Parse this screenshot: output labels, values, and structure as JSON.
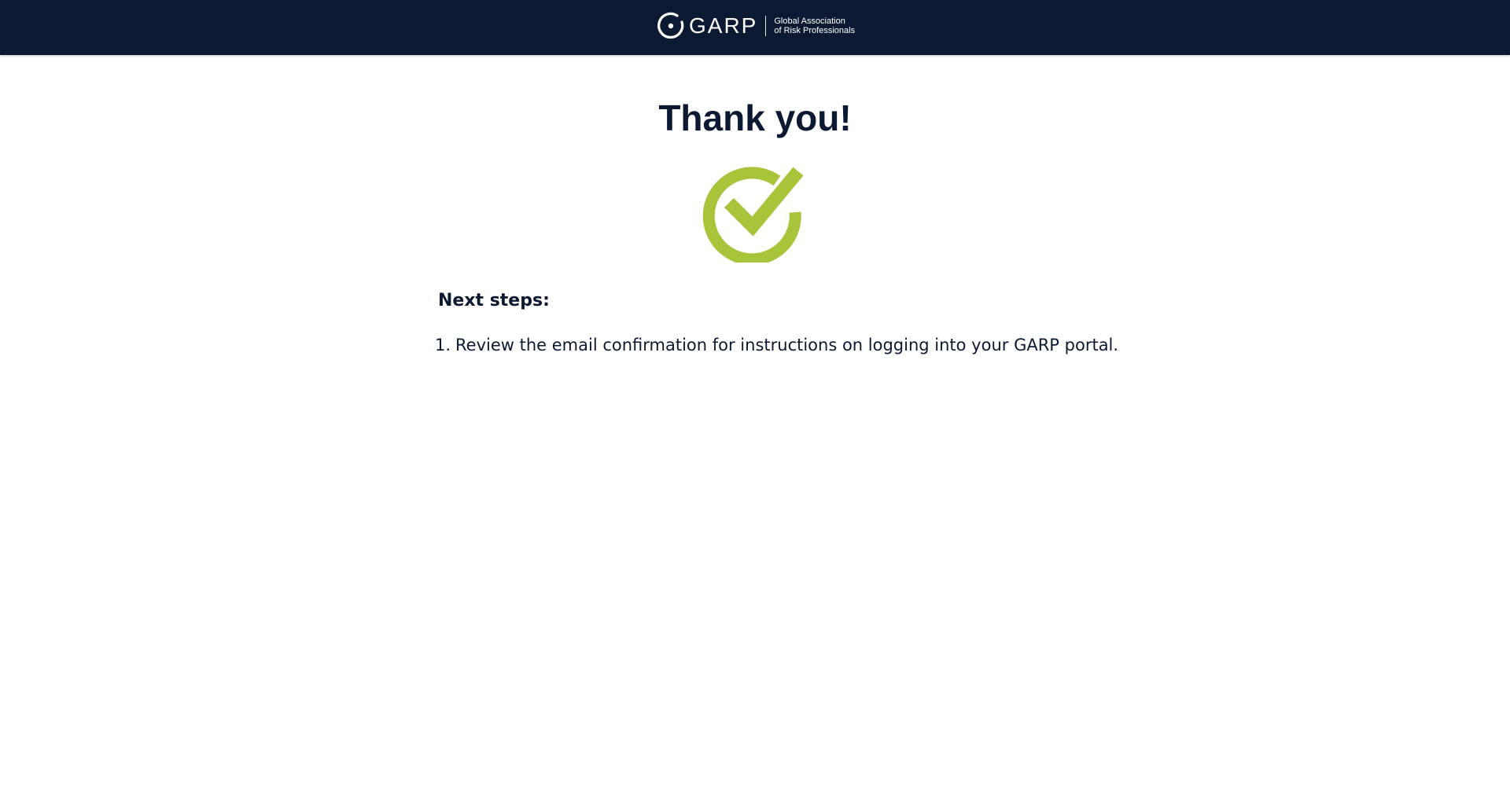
{
  "header": {
    "logo_word": "GARP",
    "logo_tagline_line1": "Global Association",
    "logo_tagline_line2": "of Risk Professionals",
    "background_color": "#0b1a32"
  },
  "main": {
    "title": "Thank you!",
    "success_icon": "check-circle-icon",
    "success_color": "#a8c43a",
    "next_steps_heading": "Next steps:",
    "steps": [
      {
        "number": "1.",
        "text": "Review the email confirmation for instructions on logging into your GARP portal."
      }
    ]
  }
}
